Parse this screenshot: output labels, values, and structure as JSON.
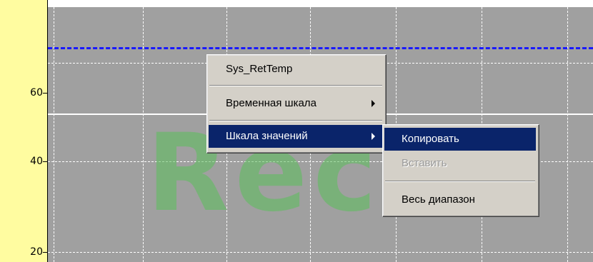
{
  "y_axis": {
    "ticks": [
      "60",
      "40",
      "20"
    ]
  },
  "watermark": {
    "text": "Reco"
  },
  "context_menu": {
    "items": [
      {
        "label": "Sys_RetTemp"
      },
      {
        "label": "Временная шкала",
        "submenu": true
      },
      {
        "label": "Шкала значений",
        "submenu": true,
        "active": true
      }
    ]
  },
  "submenu": {
    "items": [
      {
        "label": "Копировать",
        "active": true
      },
      {
        "label": "Вставить",
        "disabled": true
      },
      {
        "label": "Весь диапазон"
      }
    ]
  },
  "colors": {
    "axis_background": "#fffca0",
    "plot_background": "#a0a0a0",
    "grid": "#ffffff",
    "limit_line": "#1a1aff",
    "watermark": "#5bbf5b",
    "menu_highlight": "#0a246a"
  }
}
